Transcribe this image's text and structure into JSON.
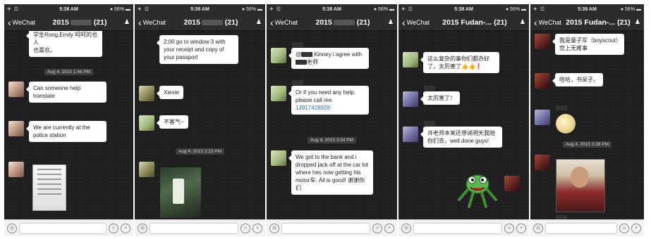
{
  "status": {
    "signal": "✈ ☲",
    "time": "5:38 AM",
    "battery": "● 56% ▬"
  },
  "nav": {
    "back_label": "WeChat",
    "people_icon": "♟"
  },
  "input": {
    "voice_icon": "◎",
    "emoji_icon": "☺",
    "plus_icon": "+"
  },
  "screens": [
    {
      "title": "2015",
      "count": "(21)",
      "msg_top": "学生Rong,Emily 呵呵的也人\n也喜欢。",
      "timestamp": "Aug 4, 2015 1:46 PM",
      "msg_1": "Can someone help translate",
      "msg_2": "We are currently at the police station"
    },
    {
      "title": "2015",
      "count": "(21)",
      "msg_top": "2:00 go to window 3 with your receipt and copy of your passport",
      "msg_1": "Xiexie",
      "msg_2": "不客气~",
      "timestamp": "Aug 4, 2015 2:23 PM"
    },
    {
      "title": "2015",
      "count": "(21)",
      "msg_1_prefix": "@",
      "msg_1_mid": "Kinney  i agree with",
      "msg_1_end": "老师",
      "msg_2": "Or if you need any help, please call me.",
      "msg_2_phone": "13917428928",
      "timestamp": "Aug 4, 2015 3:34 PM",
      "msg_3": "We got to the bank and i dropped jack off at the car lot where hes now getting his motor车. All is good! 谢谢你们"
    },
    {
      "title": "2015 Fudan-...",
      "count": "(21)",
      "msg_1": "这么复杂的事你们都办好了，太厉害了👍👍❗",
      "msg_2": "太厉害了！",
      "msg_3": "许老师本来还想说明天我陪你们去，well done guys!"
    },
    {
      "title": "2015 Fudan-...",
      "count": "(21)",
      "msg_1": "我是童子军（boyscout）世上无难事",
      "msg_2": "哈哈，书呆子。",
      "timestamp": "Aug 4, 2015 3:39 PM"
    }
  ]
}
